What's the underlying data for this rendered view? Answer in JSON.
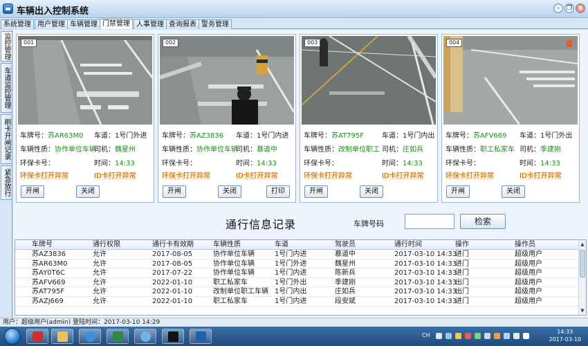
{
  "window": {
    "title": "车辆出入控制系统",
    "controls": [
      "–",
      "❐",
      "✕"
    ]
  },
  "tabs": [
    {
      "label": "系统管理"
    },
    {
      "label": "用户管理"
    },
    {
      "label": "车辆管理"
    },
    {
      "label": "门禁管理",
      "active": true
    },
    {
      "label": "人事管理"
    },
    {
      "label": "查询报表"
    },
    {
      "label": "警务管理"
    }
  ],
  "side_tabs": [
    {
      "label": "监控管理"
    },
    {
      "label": "车道监控管理"
    },
    {
      "label": "刷卡开闸记录"
    },
    {
      "label": "紧急放行"
    }
  ],
  "field_labels": {
    "plate": "车牌号：",
    "lane": "车道：",
    "nature": "车辆性质：",
    "driver": "司机：",
    "eco_card": "环保卡号：",
    "time": "时间："
  },
  "cameras": [
    {
      "id": "001",
      "plate": "苏AR63M0",
      "lane": "1号门外进",
      "nature": "协作单位车辆",
      "driver": "魏星州",
      "eco_card": "",
      "time": "14:33",
      "warn1": "环保卡打开异常",
      "warn2": "ID卡打开异常",
      "buttons": [
        "开闸",
        "关闭"
      ]
    },
    {
      "id": "002",
      "plate": "苏AZ3836",
      "lane": "1号门内进",
      "nature": "协作单位车辆",
      "driver": "慕道中",
      "eco_card": "",
      "time": "14:33",
      "warn1": "环保卡打开异常",
      "warn2": "ID卡打开异常",
      "buttons": [
        "开闸",
        "关闭",
        "打印"
      ]
    },
    {
      "id": "003",
      "plate": "苏AT795F",
      "lane": "1号门内出",
      "nature": "改制单位职工",
      "driver": "庄如兵",
      "eco_card": "",
      "time": "14:33",
      "warn1": "环保卡打开异常",
      "warn2": "ID卡打开异常",
      "buttons": [
        "开闸",
        "关闭"
      ]
    },
    {
      "id": "004",
      "plate": "苏AFV669",
      "lane": "1号门外出",
      "nature": "职工私家车",
      "driver": "季建刚",
      "eco_card": "",
      "time": "14:33",
      "warn1": "环保卡打开异常",
      "warn2": "ID卡打开异常",
      "buttons": [
        "开闸",
        "关闭"
      ]
    }
  ],
  "search": {
    "title": "通行信息记录",
    "plate_label": "车牌号码",
    "plate_value": "",
    "button": "检索"
  },
  "table": {
    "columns": [
      "车牌号",
      "通行权限",
      "通行卡有效期",
      "车辆性质",
      "车道",
      "驾驶员",
      "通行时间",
      "操作",
      "操作员"
    ],
    "rows": [
      [
        "苏AZ3836",
        "允许",
        "2017-08-05",
        "协作单位车辆",
        "1号门内进",
        "慕道中",
        "2017-03-10 14:33",
        "进门",
        "超级用户"
      ],
      [
        "苏AR63M0",
        "允许",
        "2017-08-05",
        "协作单位车辆",
        "1号门外进",
        "魏星州",
        "2017-03-10 14:33",
        "进门",
        "超级用户"
      ],
      [
        "苏AY0T6C",
        "允许",
        "2017-07-22",
        "协作单位车辆",
        "1号门内进",
        "陈新兵",
        "2017-03-10 14:33",
        "进门",
        "超级用户"
      ],
      [
        "苏AFV669",
        "允许",
        "2022-01-10",
        "职工私家车",
        "1号门外出",
        "季建刚",
        "2017-03-10 14:33",
        "出门",
        "超级用户"
      ],
      [
        "苏AT795F",
        "允许",
        "2022-01-10",
        "改制单位职工车辆",
        "1号门内出",
        "庄如兵",
        "2017-03-10 14:33",
        "出门",
        "超级用户"
      ],
      [
        "苏AZJ669",
        "允许",
        "2022-01-10",
        "职工私家车",
        "1号门内进",
        "段安斌",
        "2017-03-10 14:33",
        "进门",
        "超级用户"
      ]
    ]
  },
  "status": {
    "text": "用户：超级用户(admin)  登陆时间：2017-03-10 14:29"
  },
  "taskbar": {
    "time": "14:33",
    "date": "2017-03-10",
    "lang": "CH"
  },
  "colors": {
    "value_green": "#1f8b1f",
    "warn_orange": "#c86400",
    "accent_blue": "#7fa6d2"
  }
}
